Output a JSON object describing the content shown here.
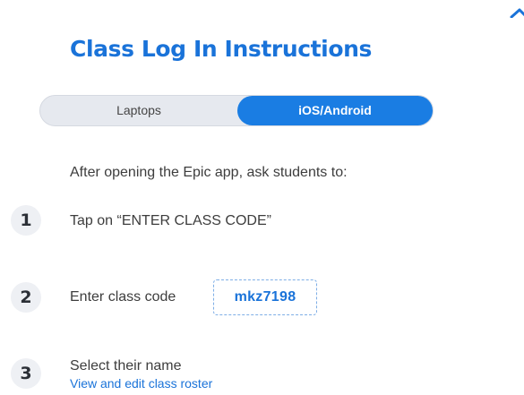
{
  "title": "Class Log In Instructions",
  "toggle": {
    "left_label": "Laptops",
    "right_label": "iOS/Android",
    "selected": "iOS/Android"
  },
  "intro": "After opening the Epic app, ask students to:",
  "steps": [
    {
      "number": "1",
      "text": "Tap on “ENTER CLASS CODE”"
    },
    {
      "number": "2",
      "text": "Enter class code",
      "code": "mkz7198"
    },
    {
      "number": "3",
      "text": "Select their name",
      "link": "View and edit class roster"
    }
  ],
  "colors": {
    "accent": "#1a73d9",
    "toggle_active": "#1a7de3",
    "toggle_bg": "#e6e9ef",
    "step_badge_bg": "#eef0f4"
  },
  "icons": {
    "corner": "chevron-up-icon"
  }
}
